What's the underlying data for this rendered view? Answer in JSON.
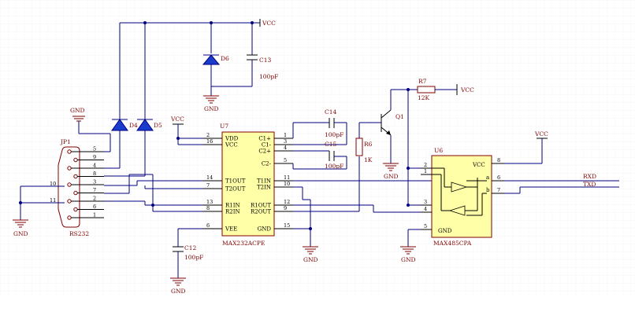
{
  "power": {
    "vcc": "VCC",
    "gnd": "GND"
  },
  "connector": {
    "ref": "JP1",
    "name": "RS232",
    "pins": [
      "5",
      "9",
      "4",
      "8",
      "3",
      "7",
      "2",
      "6",
      "1"
    ],
    "shield_pins": [
      "10",
      "11"
    ]
  },
  "diodes": {
    "d4": "D4",
    "d5": "D5",
    "d6": "D6"
  },
  "capacitors": {
    "c13": {
      "ref": "C13",
      "value": "100pF"
    },
    "c14": {
      "ref": "C14",
      "value": "100pF"
    },
    "c15": {
      "ref": "C15",
      "value": "100pF"
    },
    "c12": {
      "ref": "C12",
      "value": "100pF"
    }
  },
  "resistors": {
    "r6": {
      "ref": "R6",
      "value": "1K"
    },
    "r7": {
      "ref": "R7",
      "value": "12K"
    }
  },
  "transistor": {
    "ref": "Q1"
  },
  "u7": {
    "ref": "U7",
    "part": "MAX232ACPE",
    "left_pins": [
      {
        "num": "2",
        "name": "VDD"
      },
      {
        "num": "16",
        "name": "VCC"
      },
      {
        "num": "14",
        "name": "T1OUT"
      },
      {
        "num": "7",
        "name": "T2OUT"
      },
      {
        "num": "13",
        "name": "R1IN"
      },
      {
        "num": "8",
        "name": "R2IN"
      },
      {
        "num": "6",
        "name": "VEE"
      }
    ],
    "right_pins": [
      {
        "num": "1",
        "name": "C1+"
      },
      {
        "num": "3",
        "name": "C1-"
      },
      {
        "num": "4",
        "name": "C2+"
      },
      {
        "num": "5",
        "name": "C2-"
      },
      {
        "num": "11",
        "name": "T1IN"
      },
      {
        "num": "10",
        "name": "T2IN"
      },
      {
        "num": "12",
        "name": "R1OUT"
      },
      {
        "num": "9",
        "name": "R2OUT"
      },
      {
        "num": "15",
        "name": "GND"
      }
    ]
  },
  "u6": {
    "ref": "U6",
    "part": "MAX485CPA",
    "pins": {
      "p2": "2",
      "p1": "1",
      "p3": "3",
      "p4": "4",
      "p5": "5",
      "p8": "8",
      "p6": "6",
      "p7": "7"
    },
    "vcc_label": "VCC",
    "gnd_label": "GND",
    "pin_a": "a",
    "pin_b": "b"
  },
  "nets": {
    "rxd": "RXD",
    "txd": "TXD"
  }
}
